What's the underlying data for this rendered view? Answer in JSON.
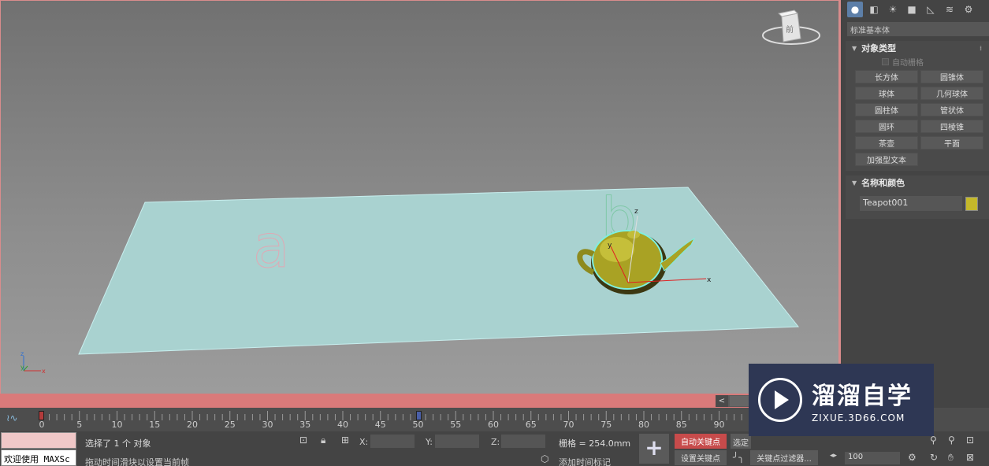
{
  "viewport": {
    "viewcube_label": "前",
    "text_objects": [
      "a",
      "b"
    ],
    "axis_labels": {
      "x": "x",
      "y": "y",
      "z": "z"
    }
  },
  "command_panel": {
    "tabs": [
      "create-icon",
      "modify-icon",
      "hierarchy-icon",
      "motion-icon",
      "display-icon",
      "utilities-icon",
      "extra-icon"
    ],
    "category": "标准基本体",
    "object_type": {
      "title": "对象类型",
      "autogrid": "自动栅格",
      "buttons": [
        "长方体",
        "圆锥体",
        "球体",
        "几何球体",
        "圆柱体",
        "管状体",
        "圆环",
        "四棱锥",
        "茶壶",
        "平面",
        "加强型文本"
      ]
    },
    "name_color": {
      "title": "名称和颜色",
      "name": "Teapot001",
      "color": "#c4b82a"
    }
  },
  "timeline": {
    "ticks": [
      0,
      5,
      10,
      15,
      20,
      25,
      30,
      35,
      40,
      45,
      50,
      55,
      60,
      65,
      70,
      75,
      80,
      85,
      90
    ],
    "current_frame": 50,
    "scroll_arrow": "<"
  },
  "status": {
    "maxscript_text": "欢迎使用 MAXSc",
    "selection": "选择了 1 个 对象",
    "hint": "拖动时间滑块以设置当前帧",
    "coord_labels": [
      "X:",
      "Y:",
      "Z:"
    ],
    "grid": "栅格 = 254.0mm",
    "add_time_tag": "添加时间标记",
    "auto_key": "自动关键点",
    "set_key": "设置关键点",
    "selected_dropdown": "选定",
    "key_filters": "关键点过滤器...",
    "frame_value": "100"
  },
  "watermark": {
    "title": "溜溜自学",
    "url": "ZIXUE.3D66.COM"
  }
}
